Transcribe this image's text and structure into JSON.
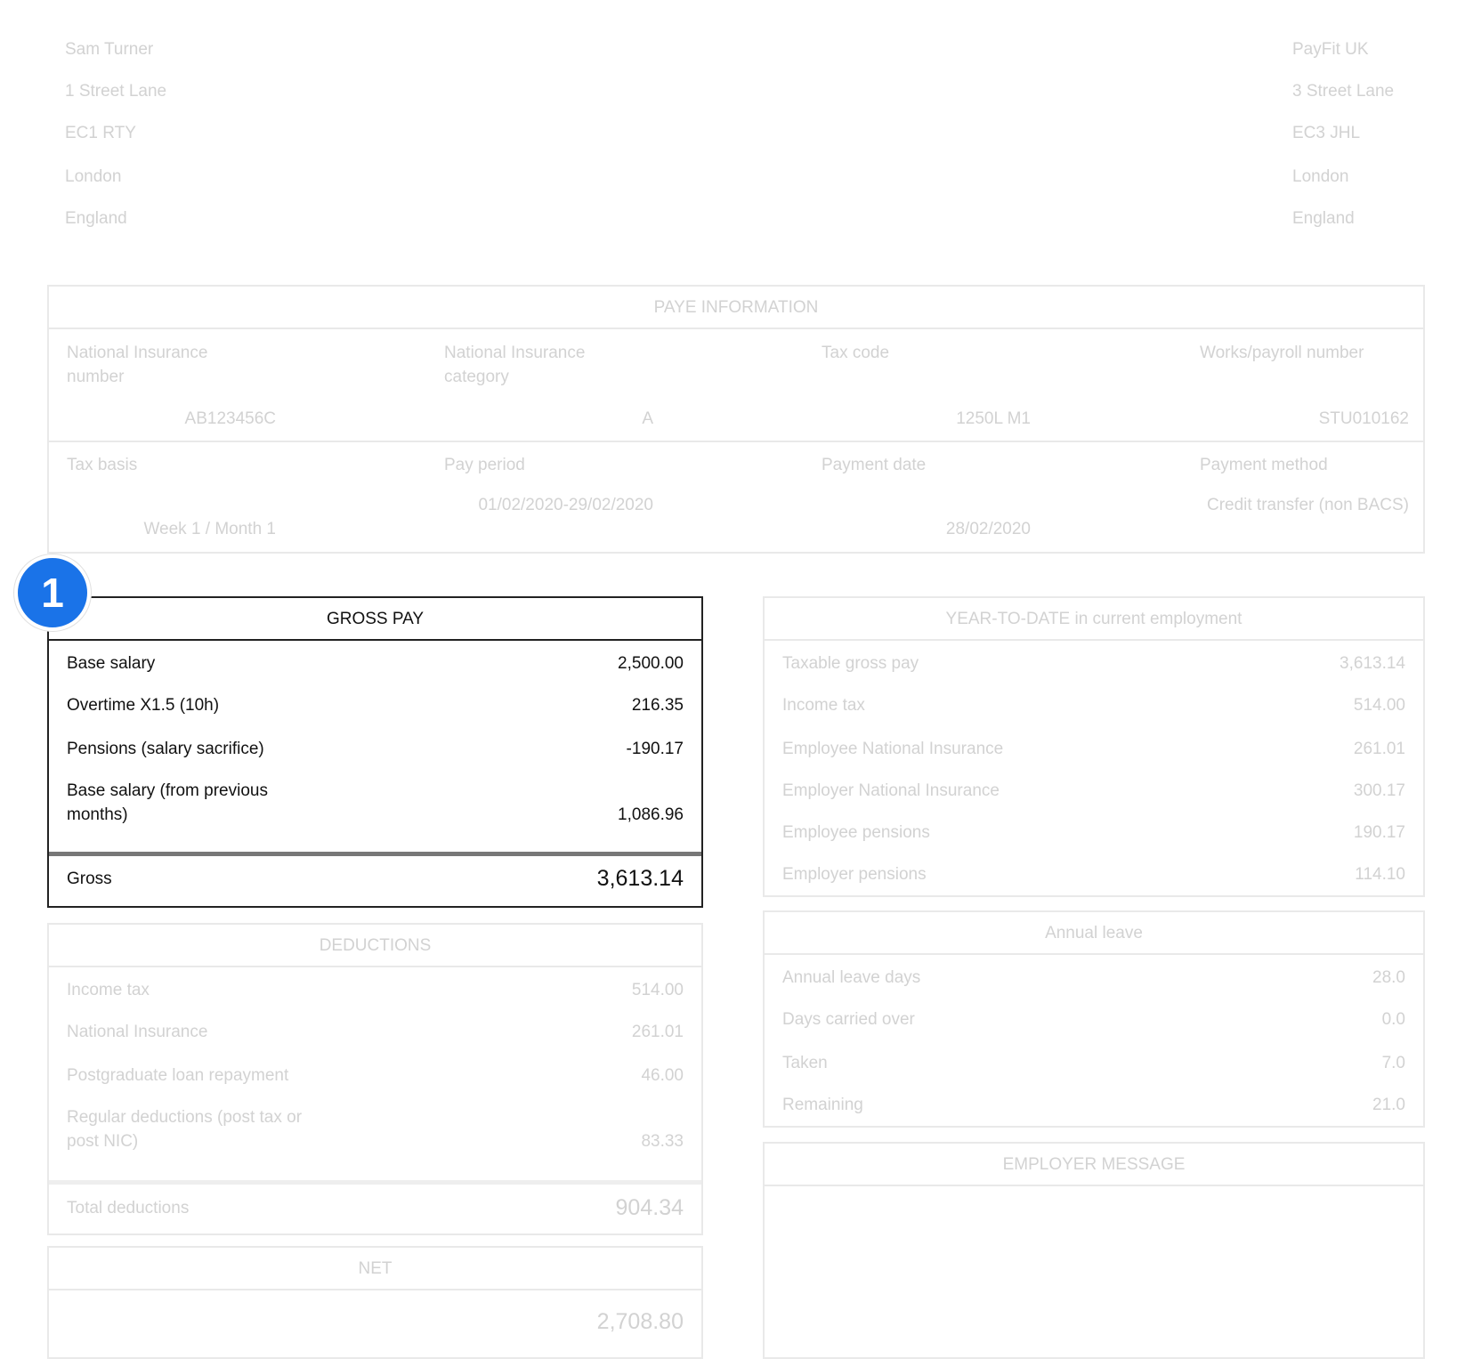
{
  "employee": {
    "name": "Sam Turner",
    "address": [
      "1 Street Lane",
      "EC1 RTY",
      "London",
      "England"
    ]
  },
  "employer": {
    "name": "PayFit UK",
    "address": [
      "3 Street Lane",
      "EC3 JHL",
      "London",
      "England"
    ]
  },
  "paye": {
    "title": "PAYE INFORMATION",
    "ni_number_label": "National Insurance number",
    "ni_number_value": "AB123456C",
    "ni_category_label": "National Insurance category",
    "ni_category_value": "A",
    "tax_code_label": "Tax code",
    "tax_code_value": "1250L M1",
    "works_number_label": "Works/payroll number",
    "works_number_value": "STU010162",
    "tax_basis_label": "Tax basis",
    "tax_basis_value": "Week 1 / Month 1",
    "pay_period_label": "Pay period",
    "pay_period_value": "01/02/2020-29/02/2020",
    "payment_date_label": "Payment date",
    "payment_date_value": "28/02/2020",
    "payment_method_label": "Payment method",
    "payment_method_value": "Credit transfer (non BACS)"
  },
  "badge": {
    "number": "1",
    "color": "#1a73e8"
  },
  "gross_pay": {
    "title": "GROSS PAY",
    "items": [
      {
        "label": "Base salary",
        "value": "2,500.00"
      },
      {
        "label": "Overtime X1.5 (10h)",
        "value": "216.35"
      },
      {
        "label": "Pensions (salary sacrifice)",
        "value": "-190.17"
      },
      {
        "label": "Base salary (from previous months)",
        "value": "1,086.96"
      }
    ],
    "total_label": "Gross",
    "total_value": "3,613.14"
  },
  "ytd": {
    "title": "YEAR-TO-DATE in current employment",
    "items": [
      {
        "label": "Taxable gross pay",
        "value": "3,613.14"
      },
      {
        "label": "Income tax",
        "value": "514.00"
      },
      {
        "label": "Employee National Insurance",
        "value": "261.01"
      },
      {
        "label": "Employer National Insurance",
        "value": "300.17"
      },
      {
        "label": "Employee pensions",
        "value": "190.17"
      },
      {
        "label": "Employer pensions",
        "value": "114.10"
      }
    ]
  },
  "deductions": {
    "title": "DEDUCTIONS",
    "items": [
      {
        "label": "Income tax",
        "value": "514.00"
      },
      {
        "label": "National Insurance",
        "value": "261.01"
      },
      {
        "label": "Postgraduate loan repayment",
        "value": "46.00"
      },
      {
        "label": "Regular deductions (post tax or post NIC)",
        "value": "83.33"
      }
    ],
    "total_label": "Total deductions",
    "total_value": "904.34"
  },
  "annual_leave": {
    "title": "Annual leave",
    "items": [
      {
        "label": "Annual leave days",
        "value": "28.0"
      },
      {
        "label": "Days carried over",
        "value": "0.0"
      },
      {
        "label": "Taken",
        "value": "7.0"
      },
      {
        "label": "Remaining",
        "value": "21.0"
      }
    ]
  },
  "net": {
    "title": "NET",
    "value": "2,708.80"
  },
  "employer_message": {
    "title": "EMPLOYER MESSAGE"
  }
}
